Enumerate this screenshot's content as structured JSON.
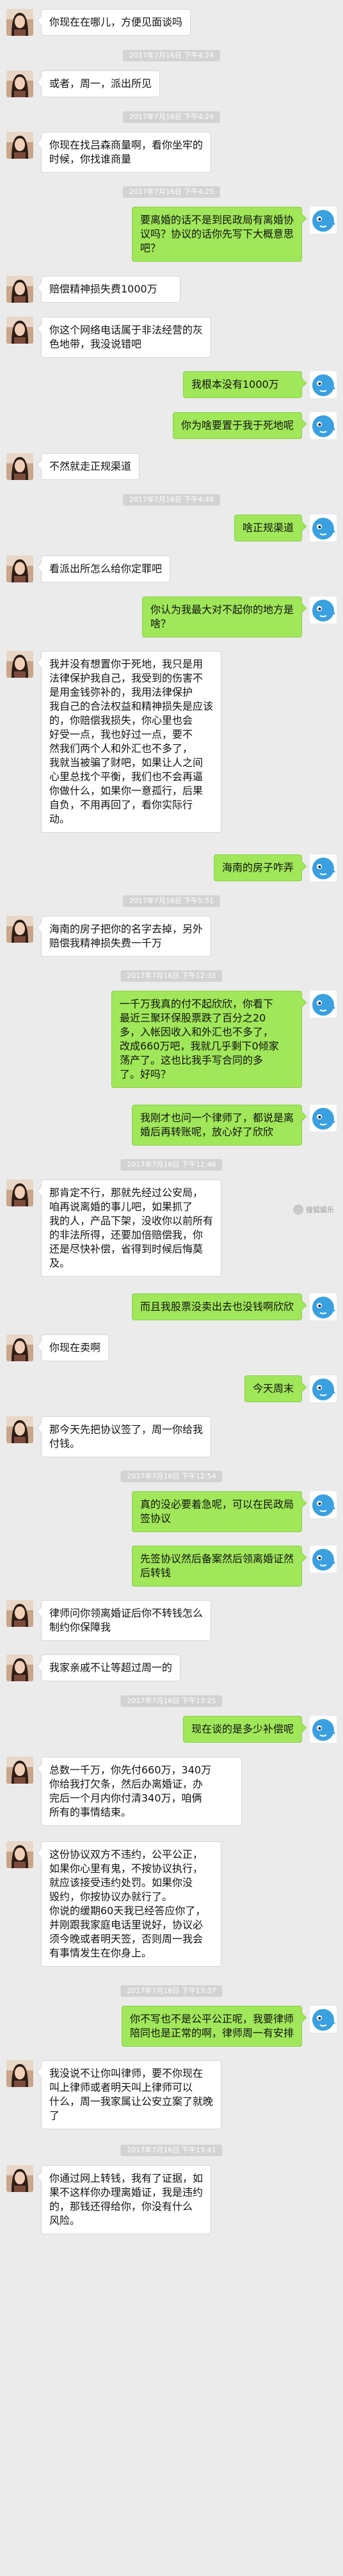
{
  "colors": {
    "background": "#ebebeb",
    "outgoing_bubble": "#a0e75a",
    "incoming_bubble": "#ffffff",
    "timestamp_badge": "#d3d3d3"
  },
  "avatars": {
    "contact": "woman-portrait-avatar",
    "self": "blue-dolphin-avatar"
  },
  "messages": [
    {
      "type": "msg",
      "side": "left",
      "text": "你现在在哪儿，方便见面谈吗"
    },
    {
      "type": "time",
      "text": "2017年7月16日 下午4:24"
    },
    {
      "type": "msg",
      "side": "left",
      "text": "或者，周一，派出所见"
    },
    {
      "type": "time",
      "text": "2017年7月16日 下午4:24"
    },
    {
      "type": "msg",
      "side": "left",
      "text": "你现在找吕森商量啊，看你坐牢的\n时候，你找谁商量"
    },
    {
      "type": "time",
      "text": "2017年7月16日 下午4:25"
    },
    {
      "type": "msg",
      "side": "right",
      "text": "要离婚的话不是到民政局有离婚协\n议吗？协议的话你先写下大概意思\n吧？"
    },
    {
      "type": "msg",
      "side": "left",
      "text": "赔偿精神损失费1000万"
    },
    {
      "type": "msg",
      "side": "left",
      "text": "你这个网络电话属于非法经营的灰\n色地带，我没说错吧"
    },
    {
      "type": "msg",
      "side": "right",
      "text": "我根本没有1000万"
    },
    {
      "type": "msg",
      "side": "right",
      "text": "你为啥要置于我于死地呢"
    },
    {
      "type": "msg",
      "side": "left",
      "text": "不然就走正规渠道"
    },
    {
      "type": "time",
      "text": "2017年7月16日 下午4:48"
    },
    {
      "type": "msg",
      "side": "right",
      "text": "啥正规渠道"
    },
    {
      "type": "msg",
      "side": "left",
      "text": "看派出所怎么给你定罪吧"
    },
    {
      "type": "msg",
      "side": "right",
      "text": "你认为我最大对不起你的地方是\n啥？"
    },
    {
      "type": "msg",
      "side": "left",
      "text": "我并没有想置你于死地，我只是用\n法律保护我自己，我受到的伤害不\n是用金钱弥补的，我用法律保护\n我自己的合法权益和精神损失是应该\n的，你赔偿我损失，你心里也会\n好受一点，我也好过一点，要不\n然我们两个人和外汇也不多了，\n我就当被骗了财吧，如果让人之间\n心里总找个平衡，我们也不会再逼\n你做什么，如果你一意孤行，后果\n自负，不用再回了，看你实际行\n动。"
    },
    {
      "type": "msg",
      "side": "right",
      "text": "海南的房子咋弄"
    },
    {
      "type": "time",
      "text": "2017年7月16日 下午5:51"
    },
    {
      "type": "msg",
      "side": "left",
      "text": "海南的房子把你的名字去掉，另外\n赔偿我精神损失费一千万"
    },
    {
      "type": "time",
      "text": "2017年7月16日 下午12:35"
    },
    {
      "type": "msg",
      "side": "right",
      "text": "一千万我真的付不起欣欣，你看下\n最近三聚环保股票跌了百分之20\n多，入帐因收入和外汇也不多了，\n改成660万吧，我就几乎剩下0倾家\n荡产了。这也比我手写合同的多\n了。好吗？"
    },
    {
      "type": "msg",
      "side": "right",
      "text": "我刚才也问一个律师了，都说是离\n婚后再转账呢，放心好了欣欣"
    },
    {
      "type": "time",
      "text": "2017年7月16日 下午12:46"
    },
    {
      "type": "msg",
      "side": "left",
      "text": "那肯定不行，那就先经过公安局，\n咱再说离婚的事儿吧，如果抓了\n我的人，产品下架，没收你以前所有\n的非法所得，还要加倍赔偿我，你\n还是尽快补偿，省得到时候后悔莫\n及。"
    },
    {
      "type": "msg",
      "side": "right",
      "text": "而且我股票没卖出去也没钱啊欣欣"
    },
    {
      "type": "msg",
      "side": "left",
      "text": "你现在卖啊"
    },
    {
      "type": "msg",
      "side": "right",
      "text": "今天周末"
    },
    {
      "type": "msg",
      "side": "left",
      "text": "那今天先把协议签了，周一你给我\n付钱。"
    },
    {
      "type": "time",
      "text": "2017年7月16日 下午12:54"
    },
    {
      "type": "msg",
      "side": "right",
      "text": "真的没必要着急呢，可以在民政局\n签协议"
    },
    {
      "type": "msg",
      "side": "right",
      "text": "先签协议然后备案然后领离婚证然\n后转钱"
    },
    {
      "type": "msg",
      "side": "left",
      "text": "律师问你领离婚证后你不转钱怎么\n制约你保障我"
    },
    {
      "type": "msg",
      "side": "left",
      "text": "我家亲戚不让等超过周一的"
    },
    {
      "type": "time",
      "text": "2017年7月16日 下午13:25"
    },
    {
      "type": "msg",
      "side": "right",
      "text": "现在谈的是多少补偿呢"
    },
    {
      "type": "msg",
      "side": "left",
      "text": "总数一千万，你先付660万，340万\n你给我打欠条，然后办离婚证，办\n完后一个月内你付清340万，咱俩\n所有的事情结束。"
    },
    {
      "type": "msg",
      "side": "left",
      "text": "这份协议双方不违约，公平公正，\n如果你心里有鬼，不按协议执行，\n就应该接受违约处罚。如果你没\n毁约，你按协议办就行了。\n你说的缓期60天我已经答应你了，\n并刚跟我家庭电话里说好，协议必\n须今晚或者明天签，否则周一我会\n有事情发生在你身上。"
    },
    {
      "type": "time",
      "text": "2017年7月16日 下午13:37"
    },
    {
      "type": "msg",
      "side": "right",
      "text": "你不写也不是公平公正呢，我要律师\n陪同也是正常的啊，律师周一有安排"
    },
    {
      "type": "msg",
      "side": "left",
      "text": "我没说不让你叫律师，要不你现在\n叫上律师或者明天叫上律师可以\n什么，周一我家属让公安立案了就晚\n了"
    },
    {
      "type": "time",
      "text": "2017年7月16日 下午13:41"
    },
    {
      "type": "msg",
      "side": "left",
      "text": "你通过网上转钱，我有了证据，如\n果不这样你办理离婚证，我是违约\n的，那钱还得给你，你没有什么\n风险。"
    }
  ],
  "watermark": "搜狐娱乐"
}
